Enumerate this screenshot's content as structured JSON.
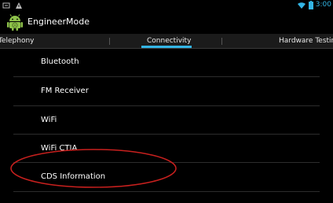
{
  "status_bar": {
    "icons": [
      "android-debug-icon",
      "warning-icon",
      "wifi-icon",
      "battery-icon"
    ],
    "time": "3:00",
    "accent": "#33b5e5"
  },
  "action_bar": {
    "title": "EngineerMode",
    "icon": "android-robot-icon"
  },
  "tabs": [
    {
      "label": "Telephony"
    },
    {
      "label": "Connectivity",
      "selected": true
    },
    {
      "label": "Hardware Testing"
    }
  ],
  "list": {
    "items": [
      {
        "label": "Bluetooth"
      },
      {
        "label": "FM Receiver"
      },
      {
        "label": "WiFi"
      },
      {
        "label": "WiFi CTIA"
      },
      {
        "label": "CDS Information"
      }
    ]
  },
  "annotation": {
    "shape": "ellipse",
    "color": "#c8201e",
    "target": "CDS Information"
  }
}
